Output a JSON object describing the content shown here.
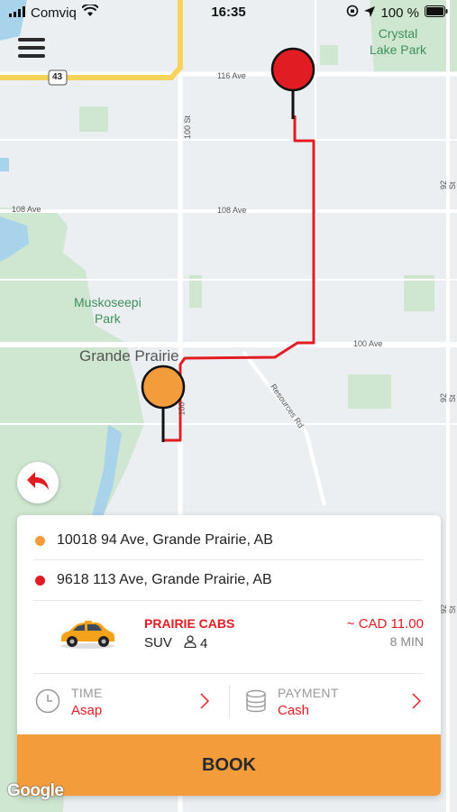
{
  "status_bar": {
    "carrier": "Comviq",
    "time": "16:35",
    "battery": "100 %"
  },
  "map": {
    "labels": {
      "crystal_lake_park": "Crystal\nLake Park",
      "muskoseepi_park": "Muskoseepi\nPark",
      "grande_prairie": "Grande Prairie",
      "ave_116": "116 Ave",
      "ave_108_left": "108 Ave",
      "ave_108": "108 Ave",
      "ave_100": "100 Ave",
      "st_100": "100 St",
      "st_92_top": "92 St",
      "st_92_mid": "92 St",
      "st_92_bot": "92 St",
      "resources_rd": "Resources Rd",
      "hwy_43": "43",
      "st_100_lower": "100"
    },
    "route_color": "#e21c23",
    "pickup_color": "#f39c3b",
    "dropoff_color": "#e21c23",
    "google": "Google"
  },
  "booking": {
    "pickup_address": "10018 94 Ave, Grande Prairie, AB",
    "dropoff_address": "9618 113 Ave, Grande Prairie, AB",
    "cab": {
      "company": "PRAIRIE CABS",
      "vehicle_type": "SUV",
      "seats": "4",
      "price": "~ CAD 11.00",
      "eta": "8 MIN"
    },
    "time_label": "TIME",
    "time_value": "Asap",
    "payment_label": "PAYMENT",
    "payment_value": "Cash",
    "book_label": "BOOK"
  },
  "colors": {
    "accent": "#e21c23",
    "button": "#f39c3b"
  }
}
